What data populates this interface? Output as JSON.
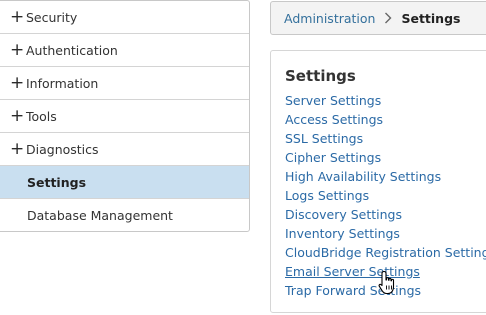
{
  "sidebar": {
    "items": [
      {
        "label": "Security",
        "expandable": true
      },
      {
        "label": "Authentication",
        "expandable": true
      },
      {
        "label": "Information",
        "expandable": true
      },
      {
        "label": "Tools",
        "expandable": true
      },
      {
        "label": "Diagnostics",
        "expandable": true
      },
      {
        "label": "Settings",
        "expandable": false,
        "selected": true
      },
      {
        "label": "Database Management",
        "expandable": false
      }
    ],
    "expand_glyph": "+",
    "selected_color": "#c9dff0"
  },
  "breadcrumb": {
    "parent": "Administration",
    "current": "Settings",
    "separator_icon": "chevron-right-icon"
  },
  "settings_panel": {
    "title": "Settings",
    "links": [
      "Server Settings",
      "Access Settings",
      "SSL Settings",
      "Cipher Settings",
      "High Availability Settings",
      "Logs Settings",
      "Discovery Settings",
      "Inventory Settings",
      "CloudBridge Registration Settings",
      "Email Server Settings",
      "Trap Forward Settings"
    ],
    "hovered_link": "Email Server Settings",
    "link_color": "#2b6aa6"
  },
  "cursor": {
    "icon": "hand-pointer-icon"
  }
}
